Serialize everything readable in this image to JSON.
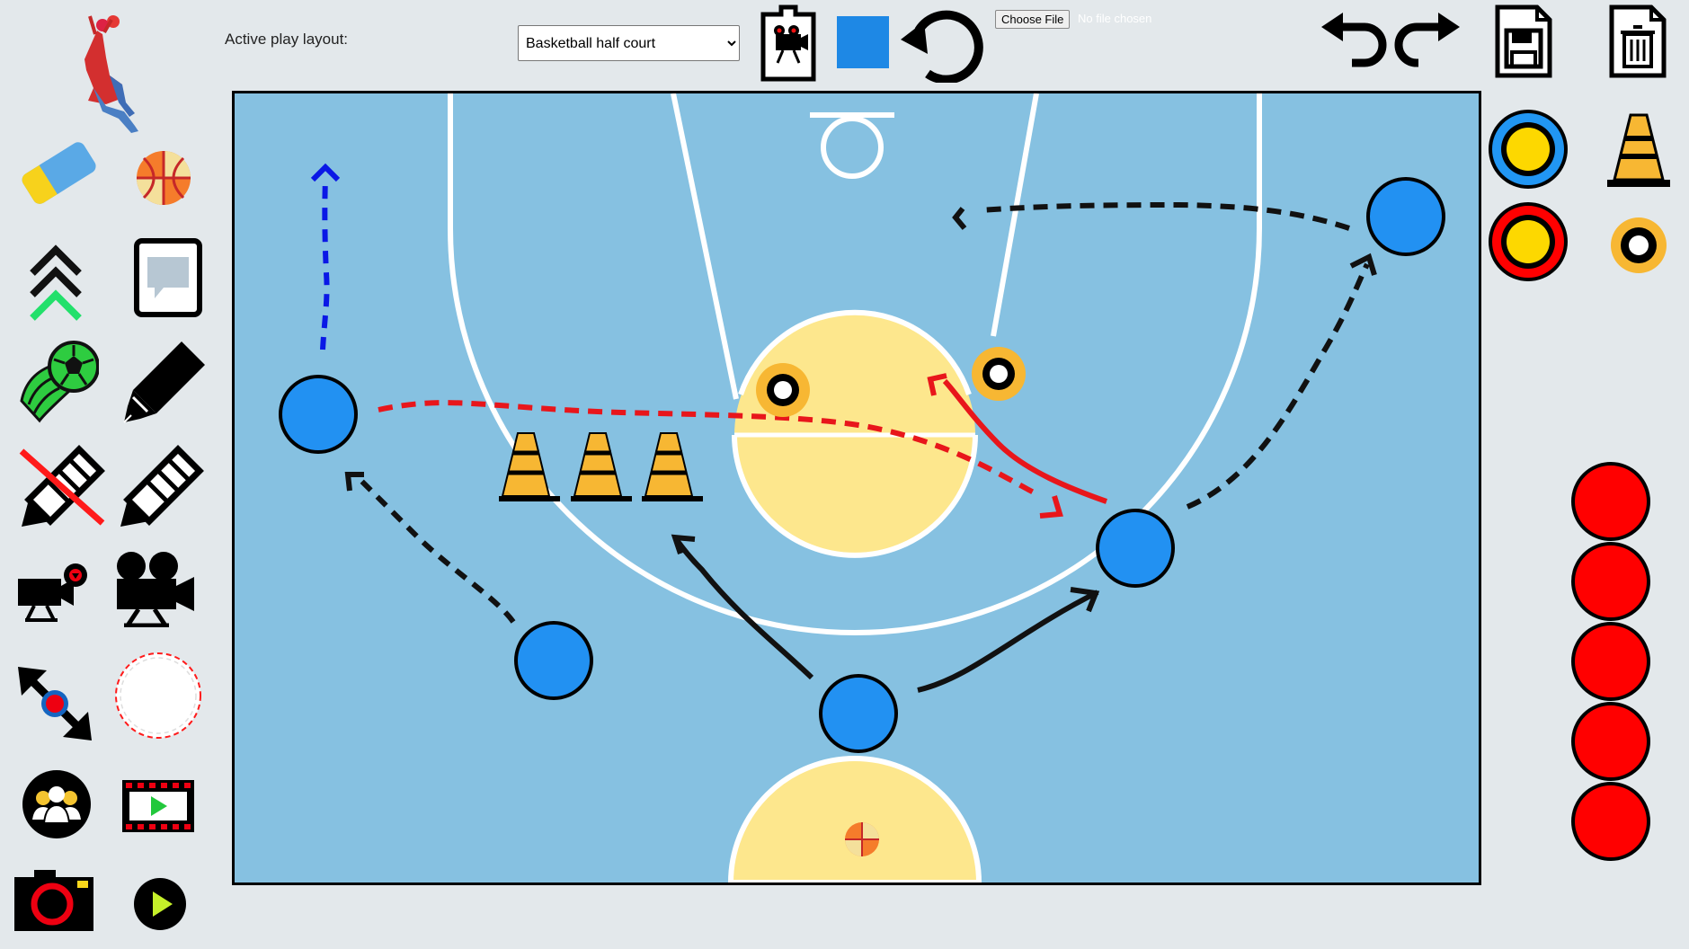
{
  "toolbar": {
    "layout_label": "Active play layout:",
    "layout_options": [
      "Basketball half court"
    ],
    "layout_selected": "Basketball half court",
    "file_button": "Choose File",
    "file_status": "No file chosen",
    "active_color": "#1e88e5"
  },
  "colors": {
    "court_blue": "#86c1e1",
    "key_yellow": "#fde78d",
    "player_blue": "#2291f2",
    "opponent_red": "#ff0000",
    "pass_red": "#e8161b",
    "dribble_blue": "#0a18e6"
  },
  "left_tools": [
    {
      "name": "logo-player-icon"
    },
    {
      "name": "eraser-icon"
    },
    {
      "name": "basketball-icon"
    },
    {
      "name": "layers-up-icon"
    },
    {
      "name": "text-note-icon"
    },
    {
      "name": "soccer-ball-icon"
    },
    {
      "name": "marker-icon"
    },
    {
      "name": "pencil-disabled-icon"
    },
    {
      "name": "pencil-icon"
    },
    {
      "name": "record-camera-icon"
    },
    {
      "name": "movie-camera-icon"
    },
    {
      "name": "resize-move-icon"
    },
    {
      "name": "dashed-circle-icon"
    },
    {
      "name": "team-icon"
    },
    {
      "name": "film-play-icon"
    },
    {
      "name": "snapshot-camera-icon"
    },
    {
      "name": "play-icon"
    }
  ],
  "right_tools": [
    {
      "name": "blue-ring-marker-icon"
    },
    {
      "name": "cone-icon"
    },
    {
      "name": "red-ring-marker-icon"
    },
    {
      "name": "small-ring-marker-icon"
    }
  ],
  "opponent_count": 5,
  "court": {
    "players": [
      {
        "name": "player-1"
      },
      {
        "name": "player-2"
      },
      {
        "name": "player-3"
      },
      {
        "name": "player-4"
      },
      {
        "name": "player-5"
      }
    ],
    "cones": 3,
    "ring_markers": 2
  }
}
